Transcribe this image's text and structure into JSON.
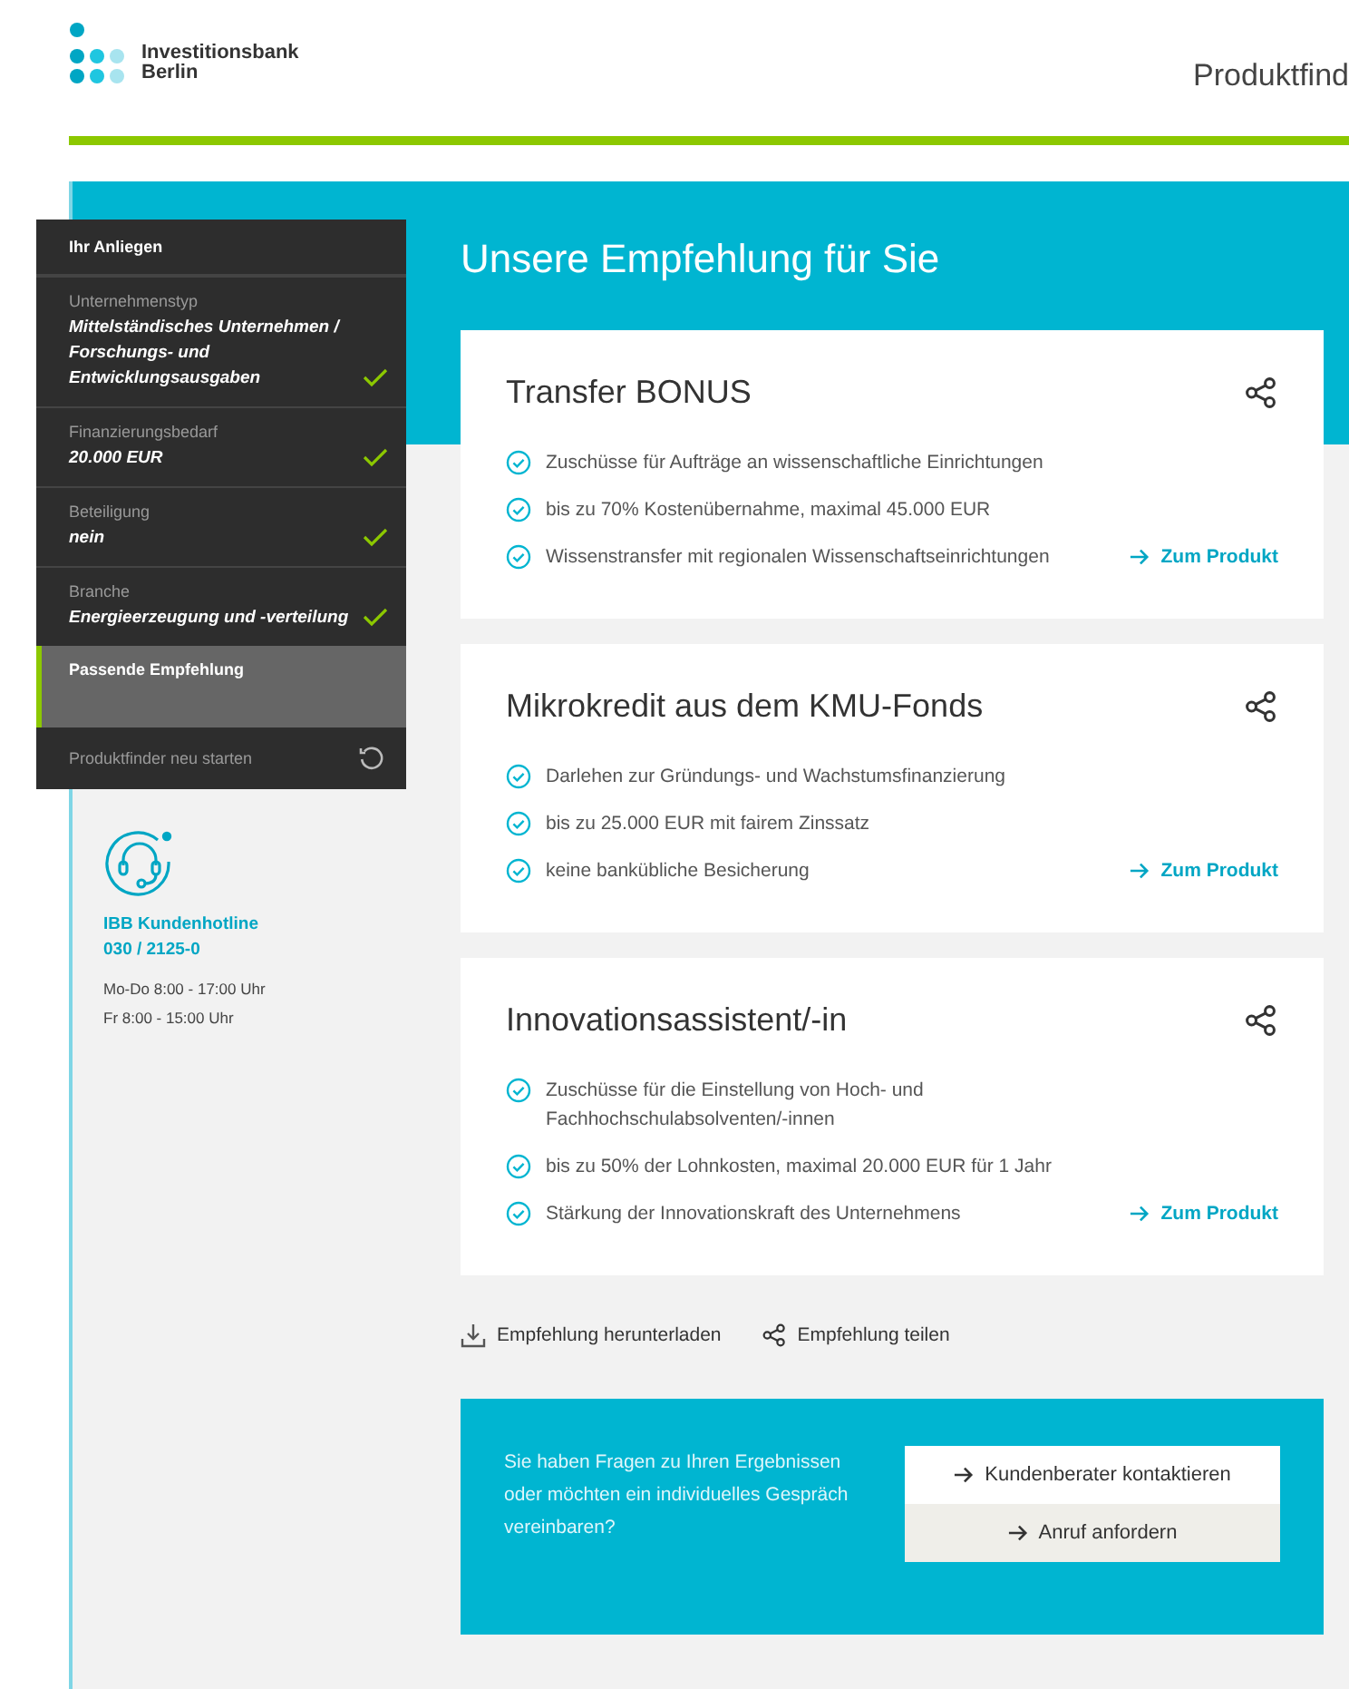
{
  "header": {
    "logo_text": [
      "Investitionsbank",
      "Berlin"
    ],
    "page_title": "Produktfind"
  },
  "sidebar": {
    "heading": "Ihr Anliegen",
    "steps": [
      {
        "label": "Unternehmenstyp",
        "value": "Mittelständisches Unternehmen / Forschungs- und Entwicklungsausgaben",
        "checked": true,
        "selected": false
      },
      {
        "label": "Finanzierungsbedarf",
        "value": "20.000 EUR",
        "checked": true,
        "selected": false
      },
      {
        "label": "Beteiligung",
        "value": "nein",
        "checked": true,
        "selected": false
      },
      {
        "label": "Branche",
        "value": "Energieerzeugung und -verteilung",
        "checked": true,
        "selected": false
      },
      {
        "label": "Passende Empfehlung",
        "checked": false,
        "selected": true
      }
    ],
    "restart": "Produktfinder neu starten"
  },
  "hotline": {
    "title": "IBB Kundenhotline",
    "phone": "030 / 2125-0",
    "hours": [
      "Mo-Do 8:00 - 17:00 Uhr",
      "Fr 8:00 - 15:00 Uhr"
    ]
  },
  "main": {
    "title": "Unsere Empfehlung für Sie",
    "products": [
      {
        "title": "Transfer BONUS",
        "points": [
          "Zuschüsse für Aufträge an wissenschaftliche Einrichtungen",
          "bis zu 70% Kostenübernahme, maximal 45.000 EUR",
          "Wissenstransfer mit regionalen Wissenschaftseinrichtungen"
        ],
        "link": "Zum Produkt"
      },
      {
        "title": "Mikrokredit aus dem KMU-Fonds",
        "points": [
          "Darlehen zur Gründungs- und Wachstumsfinanzierung",
          "bis zu 25.000 EUR mit fairem Zinssatz",
          "keine bankübliche Besicherung"
        ],
        "link": "Zum Produkt"
      },
      {
        "title": "Innovationsassistent/-in",
        "points": [
          "Zuschüsse für die Einstellung von Hoch- und Fachhochschulabsolventen/-innen",
          "bis zu 50% der Lohnkosten, maximal 20.000 EUR für 1 Jahr",
          "Stärkung der Innovationskraft des Unternehmens"
        ],
        "link": "Zum Produkt"
      }
    ],
    "actions": [
      {
        "kind": "download",
        "label": "Empfehlung herunterladen"
      },
      {
        "kind": "share",
        "label": "Empfehlung teilen"
      }
    ],
    "contact": {
      "text": "Sie haben Fragen zu Ihren Ergebnissen oder möchten ein individuelles Gespräch vereinbaren?",
      "buttons": [
        {
          "kind": "primary",
          "label": "Kundenberater kontaktieren"
        },
        {
          "kind": "secondary",
          "label": "Anruf anfordern"
        }
      ]
    }
  }
}
